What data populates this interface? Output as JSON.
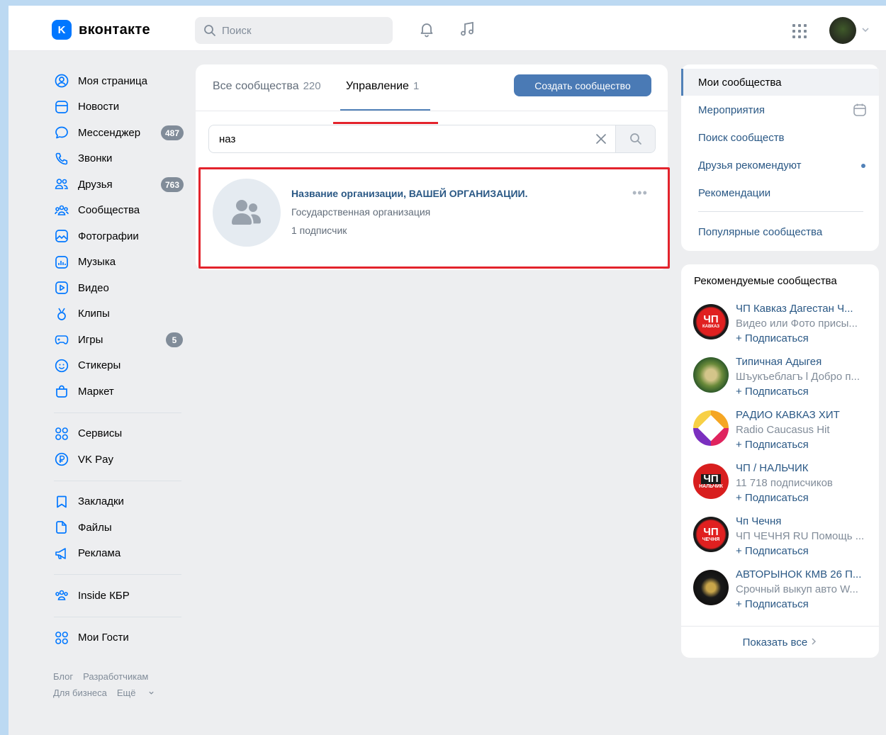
{
  "header": {
    "logo_text": "вконтакте",
    "logo_mark": "K",
    "search_placeholder": "Поиск",
    "icons": [
      "bell-icon",
      "music-icon",
      "apps-grid-icon",
      "chevron-down-icon"
    ]
  },
  "leftnav": {
    "items": [
      {
        "label": "Моя страница",
        "icon": "user-circle-icon"
      },
      {
        "label": "Новости",
        "icon": "news-icon"
      },
      {
        "label": "Мессенджер",
        "icon": "message-icon",
        "badge": "487"
      },
      {
        "label": "Звонки",
        "icon": "phone-icon"
      },
      {
        "label": "Друзья",
        "icon": "friends-icon",
        "badge": "763"
      },
      {
        "label": "Сообщества",
        "icon": "communities-icon"
      },
      {
        "label": "Фотографии",
        "icon": "photo-icon"
      },
      {
        "label": "Музыка",
        "icon": "music-icon"
      },
      {
        "label": "Видео",
        "icon": "video-icon"
      },
      {
        "label": "Клипы",
        "icon": "clips-icon"
      },
      {
        "label": "Игры",
        "icon": "game-icon",
        "badge": "5"
      },
      {
        "label": "Стикеры",
        "icon": "sticker-icon"
      },
      {
        "label": "Маркет",
        "icon": "market-icon"
      }
    ],
    "items2": [
      {
        "label": "Сервисы",
        "icon": "services-icon"
      },
      {
        "label": "VK Pay",
        "icon": "vkpay-icon"
      }
    ],
    "items3": [
      {
        "label": "Закладки",
        "icon": "bookmark-icon"
      },
      {
        "label": "Файлы",
        "icon": "file-icon"
      },
      {
        "label": "Реклама",
        "icon": "ads-icon"
      }
    ],
    "items4": [
      {
        "label": "Inside КБР",
        "icon": "communities-icon"
      }
    ],
    "items5": [
      {
        "label": "Мои Гости",
        "icon": "services-icon"
      }
    ],
    "footer": {
      "blog": "Блог",
      "developers": "Разработчикам",
      "business": "Для бизнеса",
      "more": "Ещё"
    }
  },
  "main": {
    "tabs": [
      {
        "label": "Все сообщества",
        "count": "220"
      },
      {
        "label": "Управление",
        "count": "1"
      }
    ],
    "create_button": "Создать сообщество",
    "search_value": "наз",
    "result": {
      "name": "Название организации, ВАШЕЙ ОРГАНИЗАЦИИ.",
      "type": "Государственная организация",
      "subscribers": "1 подписчик",
      "more": "•••"
    }
  },
  "right_menu": {
    "items": [
      {
        "label": "Мои сообщества"
      },
      {
        "label": "Мероприятия"
      },
      {
        "label": "Поиск сообществ"
      },
      {
        "label": "Друзья рекомендуют"
      },
      {
        "label": "Рекомендации"
      },
      {
        "label": "Популярные сообщества"
      }
    ]
  },
  "recommended": {
    "title": "Рекомендуемые сообщества",
    "subscribe_label": "+ Подписаться",
    "items": [
      {
        "name": "ЧП Кавказ Дагестан Ч...",
        "desc": "Видео или Фото присы...",
        "ava_text": "ЧП",
        "ava_sub": "КАВКАЗ"
      },
      {
        "name": "Типичная Адыгея",
        "desc": "Шъукъеблагъ l Добро п...",
        "ava_text": "",
        "ava_sub": ""
      },
      {
        "name": "РАДИО КАВКАЗ ХИТ",
        "desc": "Radio Caucasus Hit",
        "ava_text": "",
        "ava_sub": ""
      },
      {
        "name": "ЧП / НАЛЬЧИК",
        "desc": "11 718 подписчиков",
        "ava_text": "ЧП",
        "ava_sub": "НАЛЬЧИК"
      },
      {
        "name": "Чп Чечня",
        "desc": "ЧП ЧЕЧНЯ RU Помощь ...",
        "ava_text": "ЧП",
        "ava_sub": "ЧЕЧНЯ"
      },
      {
        "name": "АВТОРЫНОК КМВ 26 П...",
        "desc": "Срочный выкуп авто W...",
        "ava_text": "",
        "ava_sub": ""
      }
    ],
    "show_all": "Показать все"
  },
  "colors": {
    "accent": "#0077ff",
    "link": "#2a5885",
    "button": "#4a7ab5",
    "highlight": "#e3232c",
    "page_bg": "#edeef0",
    "outer_bg": "#bcd9f2"
  }
}
